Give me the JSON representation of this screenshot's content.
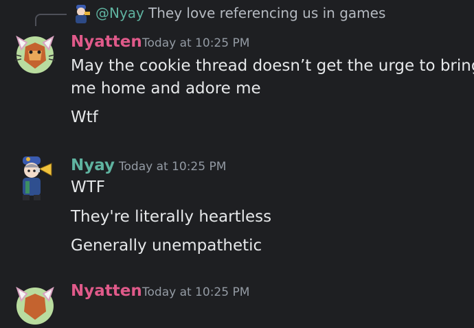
{
  "reply": {
    "author": "@Nyay",
    "text": "They love referencing us in games"
  },
  "messages": [
    {
      "author": "Nyatten",
      "timestamp": "Today at 10:25 PM",
      "lines": [
        "May the cookie thread doesn’t get the urge to bring",
        "me home and adore me",
        "Wtf"
      ]
    },
    {
      "author": "Nyay",
      "timestamp": "Today at 10:25 PM",
      "lines": [
        "WTF",
        "They're literally heartless",
        "Generally unempathetic"
      ]
    },
    {
      "author": "Nyatten",
      "timestamp": "Today at 10:25 PM",
      "lines": []
    }
  ],
  "colors": {
    "background": "#1e1f22",
    "nyatten_name": "#e05a8a",
    "nyay_name": "#5fb3a0",
    "message_text": "#e6e8ea",
    "timestamp": "#949ba4"
  }
}
